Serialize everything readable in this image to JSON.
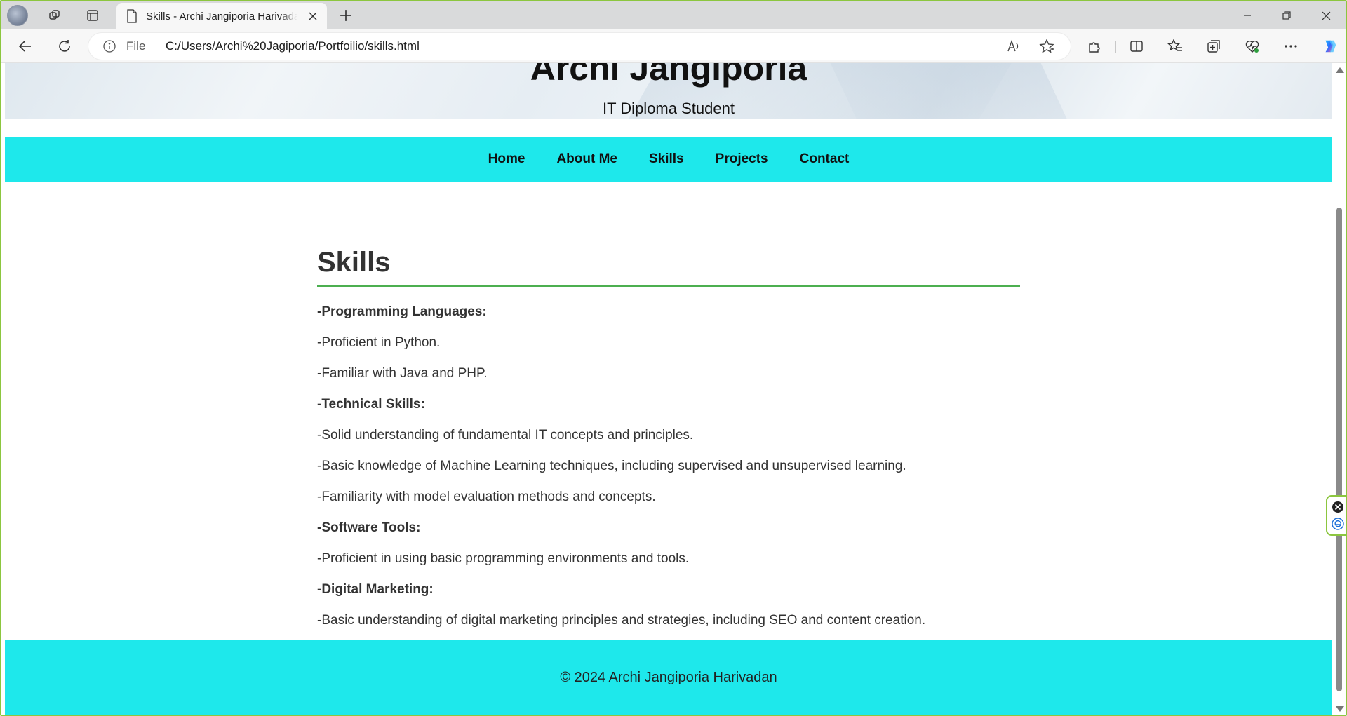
{
  "browser": {
    "tab_title": "Skills - Archi Jangiporia Harivadan",
    "address_scheme_label": "File",
    "address_url": "C:/Users/Archi%20Jagiporia/Portfoilio/skills.html"
  },
  "header": {
    "name": "Archi Jangiporia",
    "subtitle": "IT Diploma Student"
  },
  "nav": {
    "items": [
      {
        "label": "Home"
      },
      {
        "label": "About Me"
      },
      {
        "label": "Skills"
      },
      {
        "label": "Projects"
      },
      {
        "label": "Contact"
      }
    ]
  },
  "main": {
    "heading": "Skills",
    "lines": [
      {
        "text": "-Programming Languages:",
        "bold": true
      },
      {
        "text": "-Proficient in Python.",
        "bold": false
      },
      {
        "text": "-Familiar with Java and PHP.",
        "bold": false
      },
      {
        "text": "-Technical Skills:",
        "bold": true
      },
      {
        "text": "-Solid understanding of fundamental IT concepts and principles.",
        "bold": false
      },
      {
        "text": "-Basic knowledge of Machine Learning techniques, including supervised and unsupervised learning.",
        "bold": false
      },
      {
        "text": "-Familiarity with model evaluation methods and concepts.",
        "bold": false
      },
      {
        "text": "-Software Tools:",
        "bold": true
      },
      {
        "text": "-Proficient in using basic programming environments and tools.",
        "bold": false
      },
      {
        "text": "-Digital Marketing:",
        "bold": true
      },
      {
        "text": "-Basic understanding of digital marketing principles and strategies, including SEO and content creation.",
        "bold": false
      }
    ]
  },
  "footer": {
    "text": "© 2024 Archi Jangiporia Harivadan"
  },
  "colors": {
    "nav_bg": "#1ee8eb",
    "heading_rule": "#4caf50",
    "window_border": "#8cc63f"
  },
  "icons": {
    "profile": "profile-avatar",
    "workspaces": "workspaces-icon",
    "tab_actions": "vertical-tabs-icon",
    "page": "page-icon",
    "close": "close-icon",
    "new_tab": "plus-icon",
    "back": "back-arrow-icon",
    "refresh": "refresh-icon",
    "info": "info-icon",
    "read_aloud": "read-aloud-icon",
    "favorite": "star-icon",
    "extensions": "puzzle-icon",
    "split_screen": "split-screen-icon",
    "favorites": "favorites-icon",
    "collections": "collections-icon",
    "browser_essentials": "heart-pulse-icon",
    "more": "more-dots-icon",
    "copilot": "copilot-icon"
  }
}
